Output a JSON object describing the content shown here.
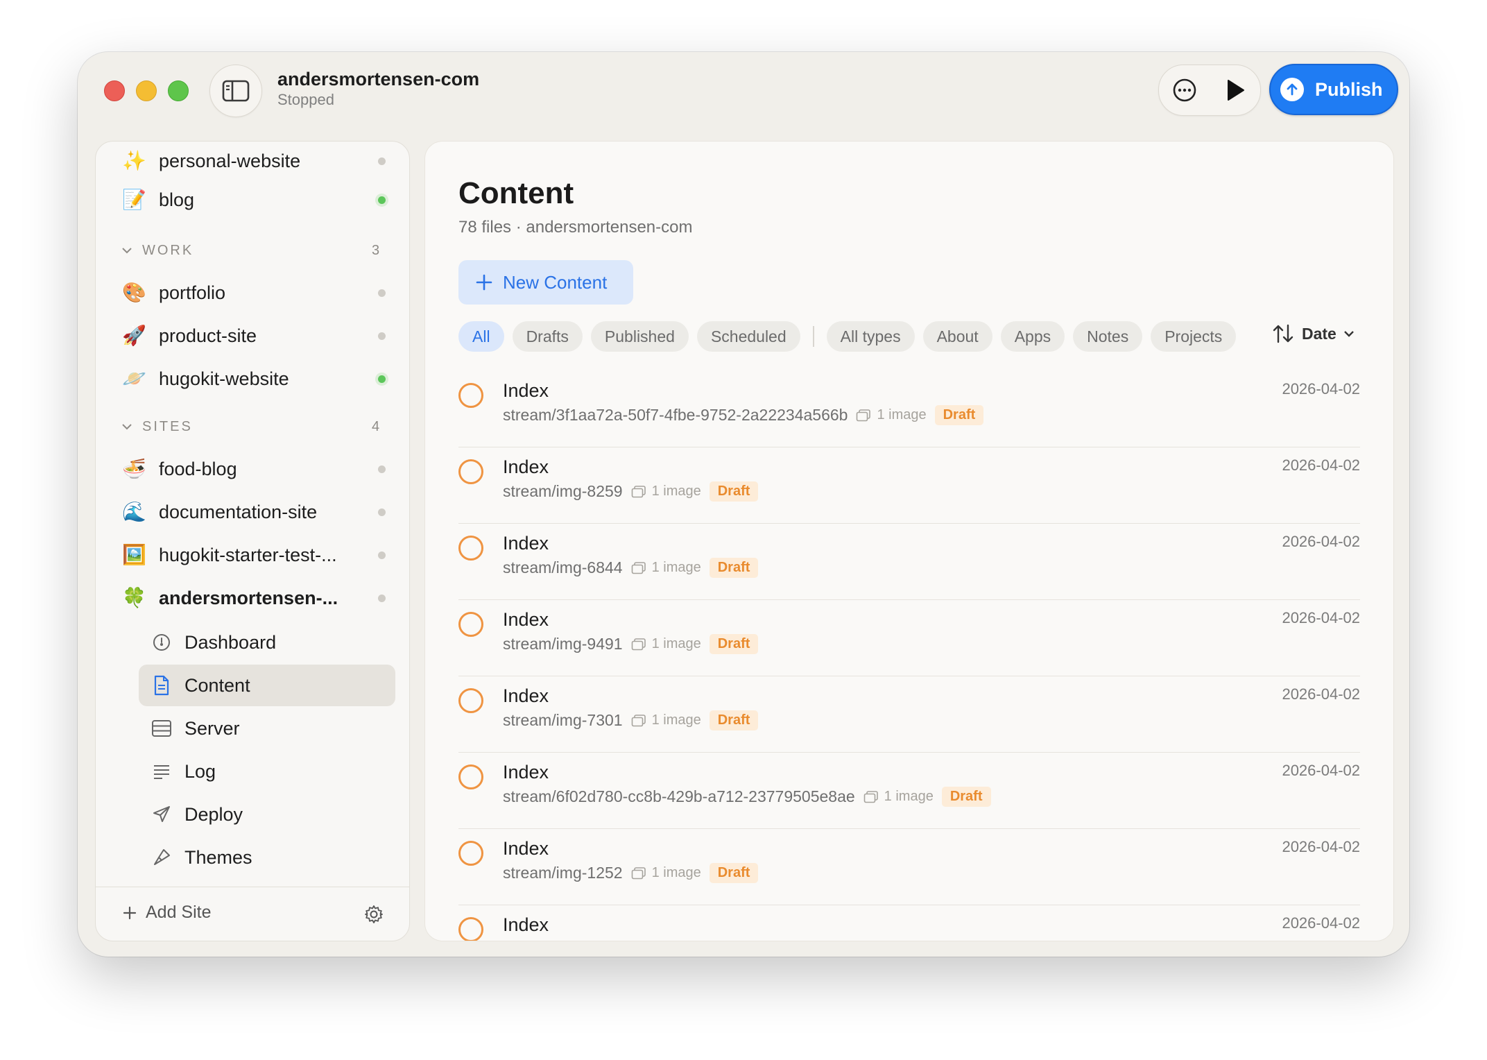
{
  "window": {
    "site_name": "andersmortensen-com",
    "status": "Stopped",
    "publish_label": "Publish"
  },
  "sidebar": {
    "top_items": [
      {
        "emoji": "✨",
        "label": "personal-website",
        "status": "idle"
      },
      {
        "emoji": "📝",
        "label": "blog",
        "status": "running"
      }
    ],
    "sections": [
      {
        "label": "WORK",
        "count": "3",
        "items": [
          {
            "emoji": "🎨",
            "label": "portfolio",
            "status": "idle"
          },
          {
            "emoji": "🚀",
            "label": "product-site",
            "status": "idle"
          },
          {
            "emoji": "🪐",
            "label": "hugokit-website",
            "status": "running"
          }
        ]
      },
      {
        "label": "SITES",
        "count": "4",
        "items": [
          {
            "emoji": "🍜",
            "label": "food-blog",
            "status": "idle"
          },
          {
            "emoji": "🌊",
            "label": "documentation-site",
            "status": "idle"
          },
          {
            "emoji": "🖼️",
            "label": "hugokit-starter-test-...",
            "status": "idle"
          },
          {
            "emoji": "🍀",
            "label": "andersmortensen-...",
            "status": "idle"
          }
        ]
      }
    ],
    "sub_items": [
      {
        "icon": "dashboard-icon",
        "label": "Dashboard"
      },
      {
        "icon": "document-icon",
        "label": "Content"
      },
      {
        "icon": "server-icon",
        "label": "Server"
      },
      {
        "icon": "log-icon",
        "label": "Log"
      },
      {
        "icon": "deploy-icon",
        "label": "Deploy"
      },
      {
        "icon": "themes-icon",
        "label": "Themes"
      }
    ],
    "active_sub": "Content",
    "add_site_label": "Add Site"
  },
  "main": {
    "title": "Content",
    "subtitle": "78 files · andersmortensen-com",
    "new_button_label": "New Content",
    "status_filters": [
      "All",
      "Drafts",
      "Published",
      "Scheduled"
    ],
    "type_filters": [
      "All types",
      "About",
      "Apps",
      "Notes",
      "Projects"
    ],
    "active_filter": "All",
    "sort_label": "Date",
    "rows": [
      {
        "title": "Index",
        "path": "stream/3f1aa72a-50f7-4fbe-9752-2a22234a566b",
        "images": "1 image",
        "badge": "Draft",
        "date": "2026-04-02"
      },
      {
        "title": "Index",
        "path": "stream/img-8259",
        "images": "1 image",
        "badge": "Draft",
        "date": "2026-04-02"
      },
      {
        "title": "Index",
        "path": "stream/img-6844",
        "images": "1 image",
        "badge": "Draft",
        "date": "2026-04-02"
      },
      {
        "title": "Index",
        "path": "stream/img-9491",
        "images": "1 image",
        "badge": "Draft",
        "date": "2026-04-02"
      },
      {
        "title": "Index",
        "path": "stream/img-7301",
        "images": "1 image",
        "badge": "Draft",
        "date": "2026-04-02"
      },
      {
        "title": "Index",
        "path": "stream/6f02d780-cc8b-429b-a712-23779505e8ae",
        "images": "1 image",
        "badge": "Draft",
        "date": "2026-04-02"
      },
      {
        "title": "Index",
        "path": "stream/img-1252",
        "images": "1 image",
        "badge": "Draft",
        "date": "2026-04-02"
      },
      {
        "title": "Index",
        "path": "",
        "images": "",
        "badge": "",
        "date": "2026-04-02"
      }
    ]
  },
  "colors": {
    "accent": "#1f7cf3",
    "draft": "#e98b2e",
    "running": "#5cc65a"
  }
}
